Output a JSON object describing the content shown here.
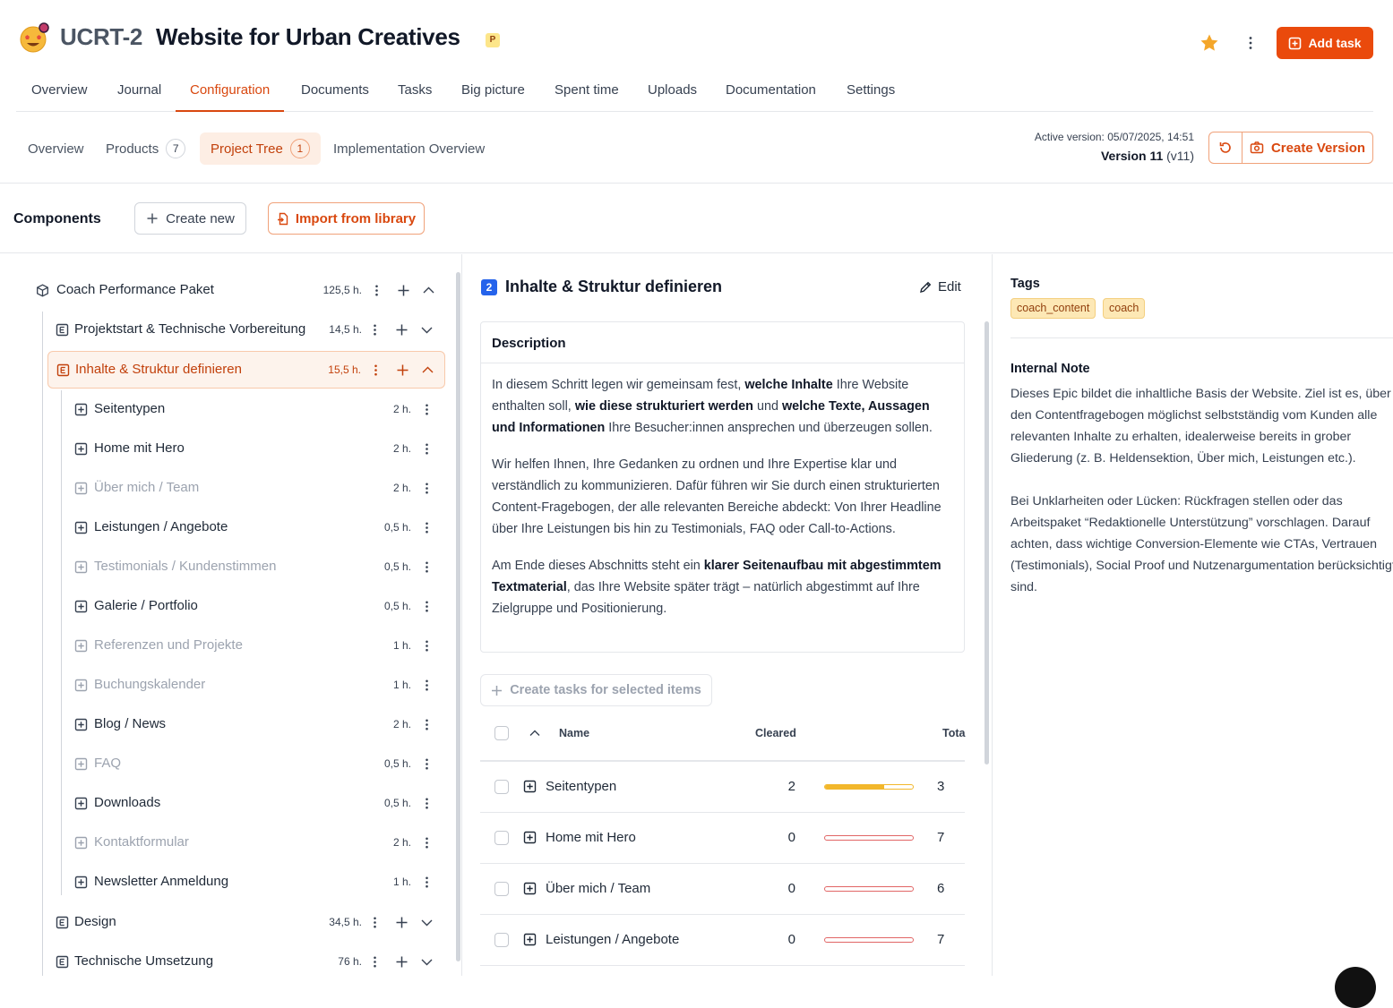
{
  "project": {
    "key": "UCRT-2",
    "title": "Website for Urban Creatives",
    "badge": "P",
    "add_task_label": "Add task"
  },
  "main_tabs": [
    "Overview",
    "Journal",
    "Configuration",
    "Documents",
    "Tasks",
    "Big picture",
    "Spent time",
    "Uploads",
    "Documentation",
    "Settings"
  ],
  "active_main_tab": "Configuration",
  "sub_tabs": {
    "overview": "Overview",
    "products": "Products",
    "products_count": "7",
    "project_tree": "Project Tree",
    "project_tree_count": "1",
    "implementation": "Implementation Overview"
  },
  "version": {
    "active_label": "Active version:",
    "active_date": "05/07/2025, 14:51",
    "name": "Version 11",
    "tag": "(v11)",
    "create_label": "Create Version"
  },
  "components": {
    "title": "Components",
    "create_new": "Create new",
    "import": "Import from library"
  },
  "tree": {
    "root": {
      "label": "Coach Performance Paket",
      "hours": "125,5 h."
    },
    "epics": [
      {
        "label": "Projektstart & Technische Vorbereitung",
        "hours": "14,5 h."
      },
      {
        "label": "Inhalte & Struktur definieren",
        "hours": "15,5 h."
      },
      {
        "label": "Design",
        "hours": "34,5 h."
      },
      {
        "label": "Technische Umsetzung",
        "hours": "76 h."
      }
    ],
    "items": [
      {
        "label": "Seitentypen",
        "hours": "2 h.",
        "muted": false
      },
      {
        "label": "Home mit Hero",
        "hours": "2 h.",
        "muted": false
      },
      {
        "label": "Über mich / Team",
        "hours": "2 h.",
        "muted": true
      },
      {
        "label": "Leistungen / Angebote",
        "hours": "0,5 h.",
        "muted": false
      },
      {
        "label": "Testimonials / Kundenstimmen",
        "hours": "0,5 h.",
        "muted": true
      },
      {
        "label": "Galerie / Portfolio",
        "hours": "0,5 h.",
        "muted": false
      },
      {
        "label": "Referenzen und Projekte",
        "hours": "1 h.",
        "muted": true
      },
      {
        "label": "Buchungskalender",
        "hours": "1 h.",
        "muted": true
      },
      {
        "label": "Blog / News",
        "hours": "2 h.",
        "muted": false
      },
      {
        "label": "FAQ",
        "hours": "0,5 h.",
        "muted": true
      },
      {
        "label": "Downloads",
        "hours": "0,5 h.",
        "muted": false
      },
      {
        "label": "Kontaktformular",
        "hours": "2 h.",
        "muted": true
      },
      {
        "label": "Newsletter Anmeldung",
        "hours": "1 h.",
        "muted": false
      }
    ]
  },
  "detail": {
    "number": "2",
    "title": "Inhalte & Struktur definieren",
    "edit_label": "Edit",
    "description_title": "Description",
    "create_tasks_label": "Create tasks for selected items",
    "columns": {
      "name": "Name",
      "cleared": "Cleared",
      "total": "Tota"
    },
    "rows": [
      {
        "name": "Seitentypen",
        "cleared": "2",
        "total": "3",
        "progress": 0.67
      },
      {
        "name": "Home mit Hero",
        "cleared": "0",
        "total": "7",
        "progress": 0
      },
      {
        "name": "Über mich / Team",
        "cleared": "0",
        "total": "6",
        "progress": 0
      },
      {
        "name": "Leistungen / Angebote",
        "cleared": "0",
        "total": "7",
        "progress": 0
      }
    ]
  },
  "tags": {
    "title": "Tags",
    "items": [
      "coach_content",
      "coach"
    ]
  },
  "note": {
    "title": "Internal Note",
    "text": "Dieses Epic bildet die inhaltliche Basis der Website. Ziel ist es, über den Contentfragebogen möglichst selbstständig vom Kunden alle relevanten Inhalte zu erhalten, idealerweise bereits in grober Gliederung (z. B. Heldensektion, Über mich, Leistungen etc.).\n\nBei Unklarheiten oder Lücken: Rückfragen stellen oder das Arbeitspaket “Redaktionelle Unterstützung” vorschlagen. Darauf achten, dass wichtige Conversion-Elemente wie CTAs, Vertrauen (Testimonials), Social Proof und Nutzenargumentation berücksichtigt sind."
  },
  "colors": {
    "accent": "#ea4a0c",
    "tag_bg": "#fde8b5",
    "progress_partial": "#f2b72b",
    "progress_empty": "#e16565"
  }
}
